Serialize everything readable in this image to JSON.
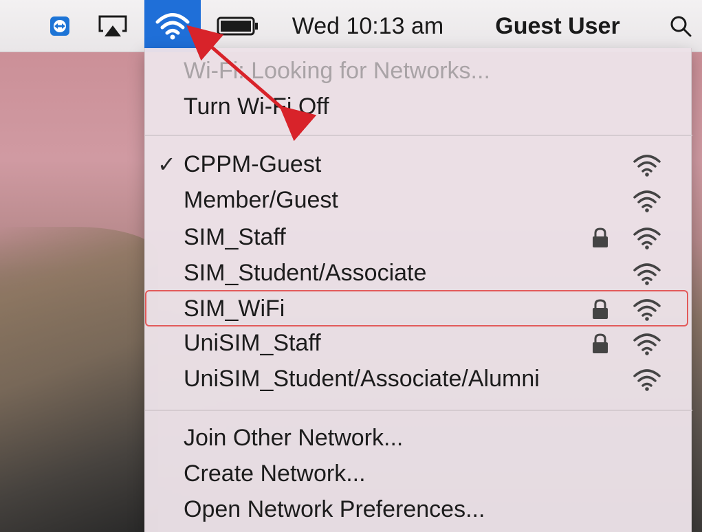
{
  "menubar": {
    "clock": "Wed 10:13 am",
    "user": "Guest User",
    "icons": [
      "teamviewer-icon",
      "airplay-icon",
      "wifi-icon",
      "battery-icon",
      "spotlight-search-icon"
    ],
    "wifi_active_color": "#1f6fd8"
  },
  "wifi_menu": {
    "status": "Wi-Fi: Looking for Networks...",
    "toggle": "Turn Wi-Fi Off",
    "networks": [
      {
        "name": "CPPM-Guest",
        "connected": true,
        "locked": false
      },
      {
        "name": "Member/Guest",
        "connected": false,
        "locked": false
      },
      {
        "name": "SIM_Staff",
        "connected": false,
        "locked": true
      },
      {
        "name": "SIM_Student/Associate",
        "connected": false,
        "locked": false
      },
      {
        "name": "SIM_WiFi",
        "connected": false,
        "locked": true,
        "highlighted": true
      },
      {
        "name": "UniSIM_Staff",
        "connected": false,
        "locked": true
      },
      {
        "name": "UniSIM_Student/Associate/Alumni",
        "connected": false,
        "locked": false
      }
    ],
    "checkmark": "✓",
    "actions": {
      "join_other": "Join Other Network...",
      "create": "Create Network...",
      "open_prefs": "Open Network Preferences..."
    }
  },
  "annotations": {
    "highlight_color": "#e25a5a",
    "arrow_color": "#d8232a"
  }
}
